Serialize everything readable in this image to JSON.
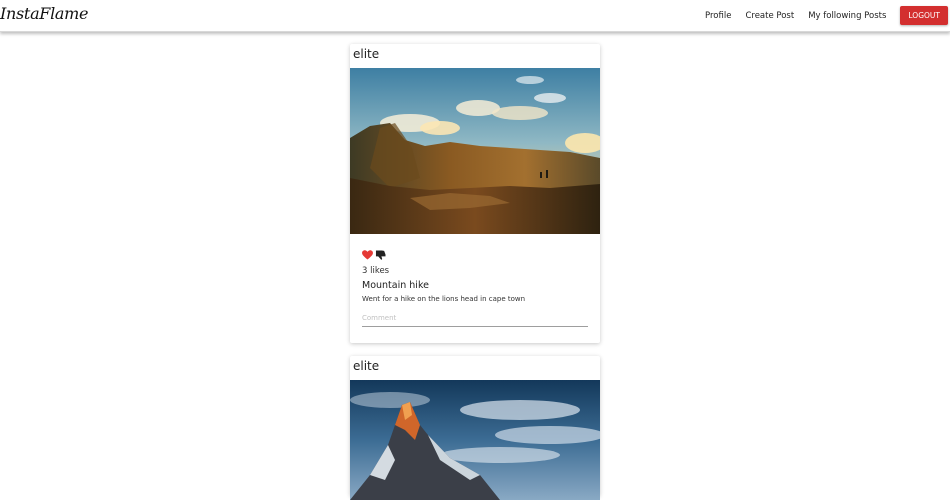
{
  "brand": {
    "name": "InstaFlame"
  },
  "nav": {
    "links": [
      "Profile",
      "Create Post",
      "My following Posts"
    ],
    "logout_label": "LOGOUT",
    "logout_color": "#d32f2f"
  },
  "posts": [
    {
      "username": "elite",
      "image": "mountain landscape at sunset",
      "icons": [
        "heart-icon",
        "thumbs-down-icon"
      ],
      "likes": "3 likes",
      "title": "Mountain hike",
      "body": "Went for a hike on the lions head in cape town",
      "comment_placeholder": "Comment"
    },
    {
      "username": "elite",
      "image": "snowy mountain peak under dramatic sky"
    }
  ]
}
